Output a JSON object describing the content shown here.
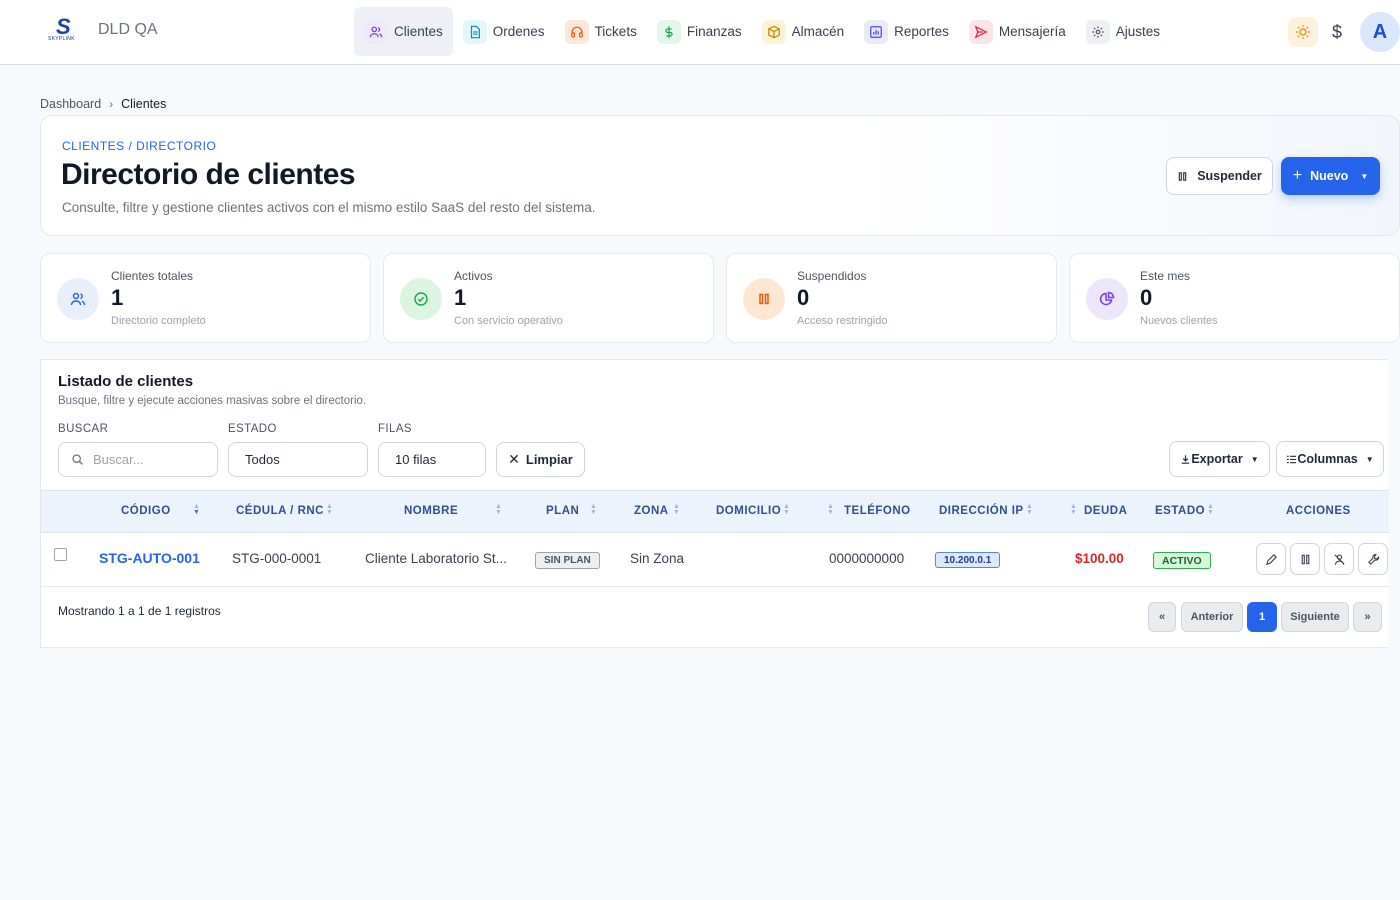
{
  "app": {
    "name": "DLD QA",
    "logo_text": "SKYPLINK"
  },
  "nav": [
    {
      "label": "Clientes",
      "icon": "users-icon",
      "color": "#f0e8fd",
      "active": true
    },
    {
      "label": "Ordenes",
      "icon": "document-icon",
      "color": "#e5f5f8"
    },
    {
      "label": "Tickets",
      "icon": "headset-icon",
      "color": "#fde7d8"
    },
    {
      "label": "Finanzas",
      "icon": "dollar-icon",
      "color": "#e3f6ea"
    },
    {
      "label": "Almacén",
      "icon": "box-icon",
      "color": "#fdf1d6"
    },
    {
      "label": "Reportes",
      "icon": "chart-icon",
      "color": "#e8eaf8"
    },
    {
      "label": "Mensajería",
      "icon": "send-icon",
      "color": "#fde2e6"
    },
    {
      "label": "Ajustes",
      "icon": "gear-icon",
      "color": "#eef0f3"
    }
  ],
  "topbar": {
    "currency_symbol": "$",
    "avatar_initial": "A"
  },
  "breadcrumb": {
    "home": "Dashboard",
    "current": "Clientes"
  },
  "hero": {
    "eyebrow": "CLIENTES / DIRECTORIO",
    "title": "Directorio de clientes",
    "subtitle": "Consulte, filtre y gestione clientes activos con el mismo estilo SaaS del resto del sistema.",
    "suspend_label": "Suspender",
    "new_label": "Nuevo"
  },
  "stats": [
    {
      "label": "Clientes totales",
      "value": "1",
      "hint": "Directorio completo",
      "icon": "users-icon",
      "bg": "#e8effb",
      "fg": "#2563eb"
    },
    {
      "label": "Activos",
      "value": "1",
      "hint": "Con servicio operativo",
      "icon": "check-circle-icon",
      "bg": "#dcf5e3",
      "fg": "#16a34a"
    },
    {
      "label": "Suspendidos",
      "value": "0",
      "hint": "Acceso restringido",
      "icon": "pause-icon",
      "bg": "#fde7d3",
      "fg": "#ea580c"
    },
    {
      "label": "Este mes",
      "value": "0",
      "hint": "Nuevos clientes",
      "icon": "pie-icon",
      "bg": "#ede6fb",
      "fg": "#7c3aed"
    }
  ],
  "list": {
    "title": "Listado de clientes",
    "subtitle": "Busque, filtre y ejecute acciones masivas sobre el directorio.",
    "filters": {
      "search_label": "BUSCAR",
      "search_placeholder": "Buscar...",
      "status_label": "ESTADO",
      "status_value": "Todos",
      "rows_label": "FILAS",
      "rows_value": "10 filas",
      "clear_label": "Limpiar"
    },
    "export_label": "Exportar",
    "columns_label": "Columnas",
    "headers": [
      "CÓDIGO",
      "CÉDULA / RNC",
      "NOMBRE",
      "PLAN",
      "ZONA",
      "DOMICILIO",
      "TELÉFONO",
      "DIRECCIÓN IP",
      "DEUDA",
      "ESTADO",
      "ACCIONES"
    ],
    "rows": [
      {
        "code": "STG-AUTO-001",
        "id": "STG-000-0001",
        "name": "Cliente Laboratorio St...",
        "plan": "SIN PLAN",
        "zone": "Sin Zona",
        "address": "",
        "phone": "0000000000",
        "ip": "10.200.0.1",
        "debt": "$100.00",
        "status": "ACTIVO"
      }
    ],
    "footer": "Mostrando 1 a 1 de 1 registros",
    "pagination": {
      "first": "«",
      "prev": "Anterior",
      "page": "1",
      "next": "Siguiente",
      "last": "»"
    }
  }
}
